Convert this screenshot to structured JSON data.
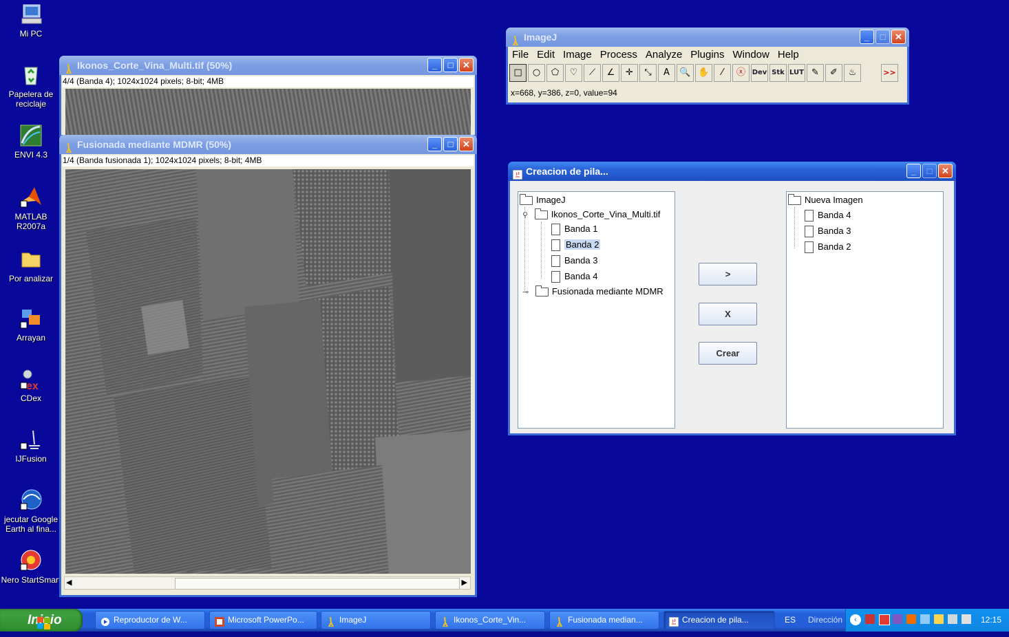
{
  "desktop": {
    "icons": [
      {
        "label": "Mi PC",
        "icon": "my-computer-icon"
      },
      {
        "label": "Papelera de reciclaje",
        "icon": "recycle-bin-icon"
      },
      {
        "label": "ENVI 4.3",
        "icon": "envi-icon"
      },
      {
        "label": "MATLAB R2007a",
        "icon": "matlab-icon"
      },
      {
        "label": "Por analizar",
        "icon": "folder-icon"
      },
      {
        "label": "Arrayan",
        "icon": "arrayan-icon"
      },
      {
        "label": "CDex",
        "icon": "cdex-icon"
      },
      {
        "label": "IJFusion",
        "icon": "ijfusion-icon"
      },
      {
        "label": "jecutar Google Earth al fina...",
        "icon": "google-earth-icon"
      },
      {
        "label": "Nero StartSmart",
        "icon": "nero-icon"
      }
    ]
  },
  "imagej": {
    "title": "ImageJ",
    "menu": [
      "File",
      "Edit",
      "Image",
      "Process",
      "Analyze",
      "Plugins",
      "Window",
      "Help"
    ],
    "tools": [
      "□",
      "○",
      "⬠",
      "♡",
      "⟋",
      "∠",
      "✛",
      "⤡",
      "A",
      "🔍",
      "✋",
      "⁄",
      "ⓧ",
      "Dev",
      "Stk",
      "LUT",
      "✎",
      "✐",
      "♨",
      "",
      ">>"
    ],
    "status": "x=668, y=386, z=0, value=94"
  },
  "window_ikonos": {
    "title": "Ikonos_Corte_Vina_Multi.tif (50%)",
    "info": "4/4 (Banda 4); 1024x1024 pixels; 8-bit; 4MB"
  },
  "window_fusionada": {
    "title": "Fusionada mediante MDMR (50%)",
    "info": "1/4 (Banda fusionada 1); 1024x1024 pixels; 8-bit; 4MB"
  },
  "dialog": {
    "title": "Creacion de pila...",
    "left_tree": {
      "root": "ImageJ",
      "file1": "Ikonos_Corte_Vina_Multi.tif",
      "bands": [
        "Banda 1",
        "Banda 2",
        "Banda 3",
        "Banda 4"
      ],
      "selected": "Banda 2",
      "file2": "Fusionada mediante MDMR"
    },
    "right_tree": {
      "root": "Nueva Imagen",
      "bands": [
        "Banda 4",
        "Banda 3",
        "Banda 2"
      ]
    },
    "buttons": {
      "add": ">",
      "remove": "X",
      "create": "Crear"
    }
  },
  "taskbar": {
    "start": "Inicio",
    "items": [
      "Reproductor de W...",
      "Microsoft PowerPo...",
      "ImageJ",
      "Ikonos_Corte_Vin...",
      "Fusionada median...",
      "Creacion de pila..."
    ],
    "lang": "ES",
    "address": "Dirección",
    "clock": "12:15"
  },
  "colors": {
    "desktop": "#08089a",
    "title_active": "#2459d0",
    "title_inactive": "#7b9ee3"
  }
}
